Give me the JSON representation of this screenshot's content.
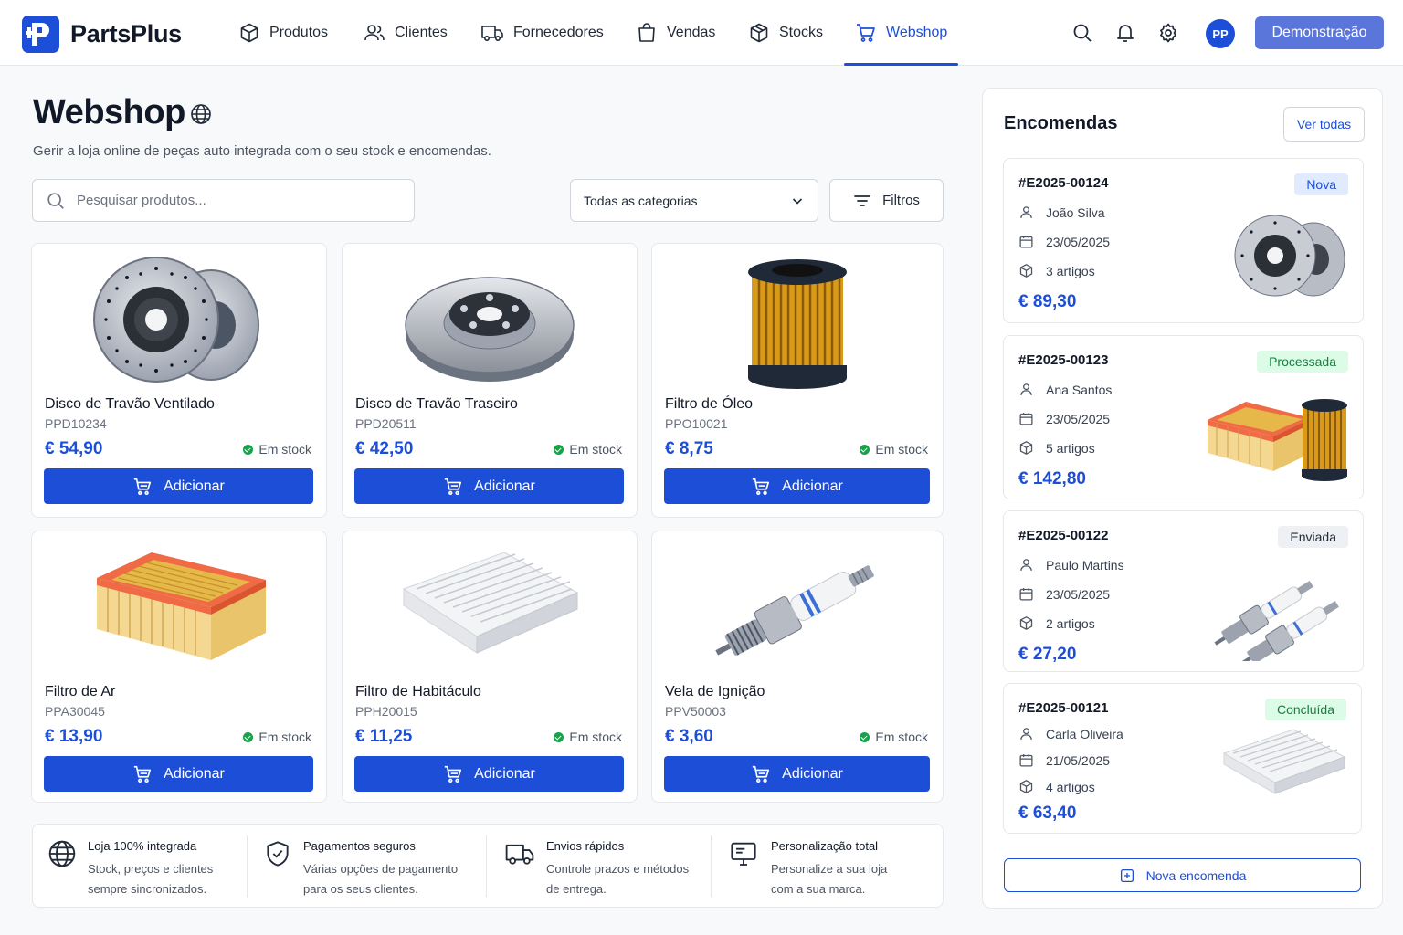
{
  "app": {
    "name": "PartsPlus",
    "brand_color": "#1d4ed8"
  },
  "nav": {
    "items": [
      {
        "label": "Produtos",
        "icon": "box-icon"
      },
      {
        "label": "Clientes",
        "icon": "users-icon"
      },
      {
        "label": "Fornecedores",
        "icon": "truck-icon"
      },
      {
        "label": "Vendas",
        "icon": "shopping-bag-icon"
      },
      {
        "label": "Stocks",
        "icon": "cube-icon"
      },
      {
        "label": "Webshop",
        "icon": "cart-icon",
        "active": true
      }
    ],
    "avatar_initials": "PP",
    "demo_label": "Demonstração"
  },
  "page": {
    "title": "Webshop",
    "subtitle": "Gerir a loja online de peças auto integrada com o seu stock e encomendas."
  },
  "toolbar": {
    "search_placeholder": "Pesquisar produtos...",
    "category_selected": "Todas as categorias",
    "filters_label": "Filtros"
  },
  "products": [
    {
      "name": "Disco de Travão Ventilado",
      "code": "PPD10234",
      "price": "€ 54,90",
      "stock": "Em stock",
      "button": "Adicionar",
      "image": "brake-discs-image"
    },
    {
      "name": "Disco de Travão Traseiro",
      "code": "PPD20511",
      "price": "€ 42,50",
      "stock": "Em stock",
      "button": "Adicionar",
      "image": "rear-brake-disc-image"
    },
    {
      "name": "Filtro de Óleo",
      "code": "PPO10021",
      "price": "€ 8,75",
      "stock": "Em stock",
      "button": "Adicionar",
      "image": "oil-filter-image"
    },
    {
      "name": "Filtro de Ar",
      "code": "PPA30045",
      "price": "€ 13,90",
      "stock": "Em stock",
      "button": "Adicionar",
      "image": "air-filter-image"
    },
    {
      "name": "Filtro de Habitáculo",
      "code": "PPH20015",
      "price": "€ 11,25",
      "stock": "Em stock",
      "button": "Adicionar",
      "image": "cabin-filter-image"
    },
    {
      "name": "Vela de Ignição",
      "code": "PPV50003",
      "price": "€ 3,60",
      "stock": "Em stock",
      "button": "Adicionar",
      "image": "spark-plug-image"
    }
  ],
  "features": [
    {
      "title": "Loja 100% integrada",
      "line1": "Stock, preços e clientes",
      "line2": "sempre sincronizados.",
      "icon": "globe-icon"
    },
    {
      "title": "Pagamentos seguros",
      "line1": "Várias opções de pagamento",
      "line2": "para os seus clientes.",
      "icon": "shield-check-icon"
    },
    {
      "title": "Envios rápidos",
      "line1": "Controle prazos e métodos",
      "line2": "de entrega.",
      "icon": "truck-icon"
    },
    {
      "title": "Personalização total",
      "line1": "Personalize a sua loja",
      "line2": "com a sua marca.",
      "icon": "monitor-icon"
    }
  ],
  "orders_panel": {
    "title": "Encomendas",
    "view_all": "Ver todas",
    "new_order": "Nova encomenda",
    "orders": [
      {
        "id": "#E2025-00124",
        "status": "Nova",
        "status_bg": "#e0ebff",
        "status_color": "#1d4ed8",
        "customer": "João Silva",
        "date": "23/05/2025",
        "items": "3 artigos",
        "total": "€ 89,30",
        "image": "brake-discs-image"
      },
      {
        "id": "#E2025-00123",
        "status": "Processada",
        "status_bg": "#dcfce7",
        "status_color": "#15803d",
        "customer": "Ana Santos",
        "date": "23/05/2025",
        "items": "5 artigos",
        "total": "€ 142,80",
        "image": "filters-image"
      },
      {
        "id": "#E2025-00122",
        "status": "Enviada",
        "status_bg": "#eef0f3",
        "status_color": "#1f2937",
        "customer": "Paulo Martins",
        "date": "23/05/2025",
        "items": "2 artigos",
        "total": "€ 27,20",
        "image": "spark-plugs-image"
      },
      {
        "id": "#E2025-00121",
        "status": "Concluída",
        "status_bg": "#dcfce7",
        "status_color": "#15803d",
        "customer": "Carla Oliveira",
        "date": "21/05/2025",
        "items": "4 artigos",
        "total": "€ 63,40",
        "image": "cabin-filter-image"
      }
    ]
  }
}
